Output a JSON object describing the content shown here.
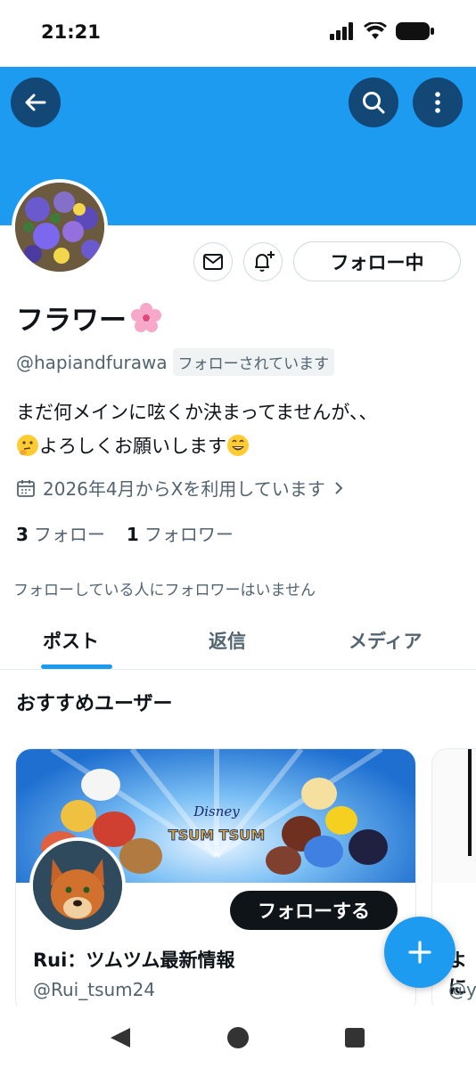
{
  "status_bar": {
    "time": "21:21"
  },
  "profile": {
    "display_name": "フラワー",
    "handle": "@hapiandfurawa",
    "follows_you_badge": "フォローされています",
    "bio_line1": "まだ何メインに呟くか決まってませんが、、",
    "bio_line2": "よろしくお願いします",
    "joined": "2026年4月からXを利用しています",
    "following_count": "3",
    "following_label": "フォロー",
    "followers_count": "1",
    "followers_label": "フォロワー",
    "mutual_note": "フォローしている人にフォロワーはいません",
    "following_button": "フォロー中"
  },
  "tabs": [
    {
      "label": "ポスト",
      "active": true
    },
    {
      "label": "返信",
      "active": false
    },
    {
      "label": "メディア",
      "active": false
    }
  ],
  "recommended": {
    "title": "おすすめユーザー",
    "cards": [
      {
        "name": "Rui：ツムツム最新情報",
        "handle": "@Rui_tsum24",
        "follow_button": "フォローする",
        "banner_logo_top": "Disney",
        "banner_logo_bottom": "TSUM TSUM"
      },
      {
        "name": "よに",
        "handle": "@y"
      }
    ]
  },
  "colors": {
    "accent": "#1d9bf0",
    "text": "#0f1419",
    "secondary": "#536471"
  },
  "icons": [
    "back-arrow-icon",
    "search-icon",
    "more-vertical-icon",
    "mail-icon",
    "bell-plus-icon",
    "calendar-icon",
    "chevron-right-icon",
    "plus-icon"
  ]
}
